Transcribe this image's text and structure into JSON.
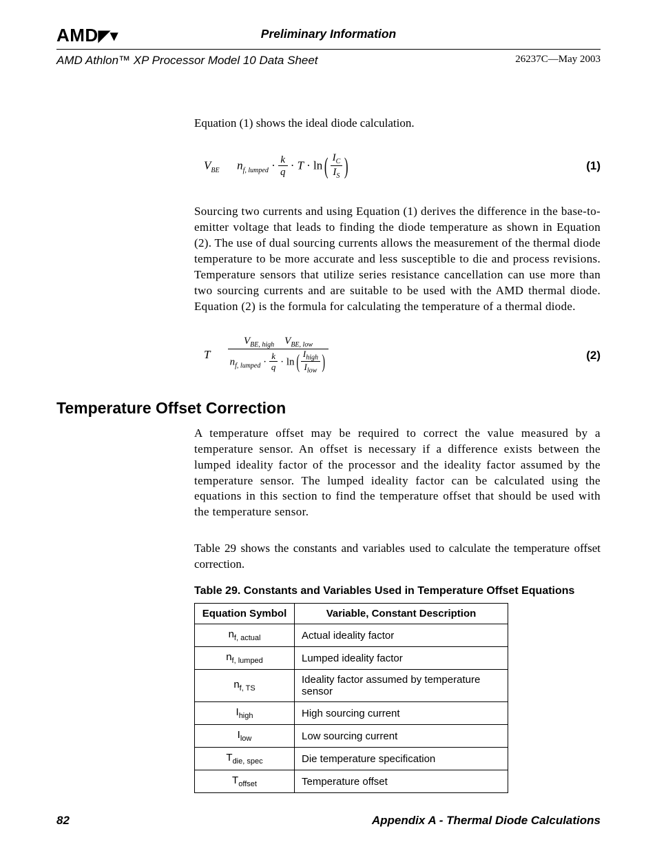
{
  "header": {
    "logo": "AMD",
    "preliminary": "Preliminary Information",
    "doc_title": "AMD Athlon™ XP Processor Model 10 Data Sheet",
    "doc_ref": "26237C—May 2003"
  },
  "p_intro": "Equation (1) shows the ideal diode calculation.",
  "eq1_num": "(1)",
  "p_eq1_desc": "Sourcing two currents and using Equation (1) derives the difference in the base-to-emitter voltage that leads to finding the diode temperature as shown in Equation (2). The use of dual sourcing currents allows the measurement of the thermal diode temperature to be more accurate and less susceptible to die and process revisions. Temperature sensors that utilize series resistance cancellation can use more than two sourcing currents and are suitable to be used with the AMD thermal diode. Equation (2) is the formula for calculating the temperature of a thermal diode.",
  "eq2_num": "(2)",
  "section_heading": "Temperature Offset Correction",
  "p_offset_intro": "A temperature offset may be required to correct the value measured by a temperature sensor.  An offset is necessary if a difference exists between the lumped ideality factor of the processor and the ideality factor assumed by the temperature sensor. The lumped ideality factor can be calculated using the equations in this section to find the temperature offset that should be used with the temperature sensor.",
  "p_table_intro": "Table 29 shows the constants and variables used to calculate the temperature offset correction.",
  "table": {
    "caption": "Table 29.   Constants and Variables Used in Temperature Offset Equations",
    "headers": [
      "Equation Symbol",
      "Variable, Constant Description"
    ],
    "rows": [
      {
        "sym_main": "n",
        "sym_sub": "f, actual",
        "desc": "Actual ideality factor"
      },
      {
        "sym_main": "n",
        "sym_sub": "f, lumped",
        "desc": "Lumped ideality factor"
      },
      {
        "sym_main": "n",
        "sym_sub": "f, TS",
        "desc": "Ideality factor assumed by temperature sensor"
      },
      {
        "sym_main": "I",
        "sym_sub": "high",
        "desc": "High sourcing current"
      },
      {
        "sym_main": "I",
        "sym_sub": "low",
        "desc": "Low sourcing current"
      },
      {
        "sym_main": "T",
        "sym_sub": "die, spec",
        "desc": "Die temperature specification"
      },
      {
        "sym_main": "T",
        "sym_sub": "offset",
        "desc": "Temperature offset"
      }
    ]
  },
  "footer": {
    "page_number": "82",
    "appendix": "Appendix A - Thermal Diode Calculations"
  },
  "equations": {
    "eq1": {
      "lhs_var": "V",
      "lhs_sub": "BE",
      "n_var": "n",
      "n_sub": "f, lumped",
      "k": "k",
      "q": "q",
      "T": "T",
      "ln": "ln",
      "Ic": "I",
      "Ic_sub": "C",
      "Is": "I",
      "Is_sub": "S"
    },
    "eq2": {
      "T": "T",
      "Vh": "V",
      "Vh_sub": "BE, high",
      "Vl": "V",
      "Vl_sub": "BE, low",
      "n_var": "n",
      "n_sub": "f, lumped",
      "k": "k",
      "q": "q",
      "ln": "ln",
      "Ih": "I",
      "Ih_sub": "high",
      "Il": "I",
      "Il_sub": "low"
    }
  }
}
